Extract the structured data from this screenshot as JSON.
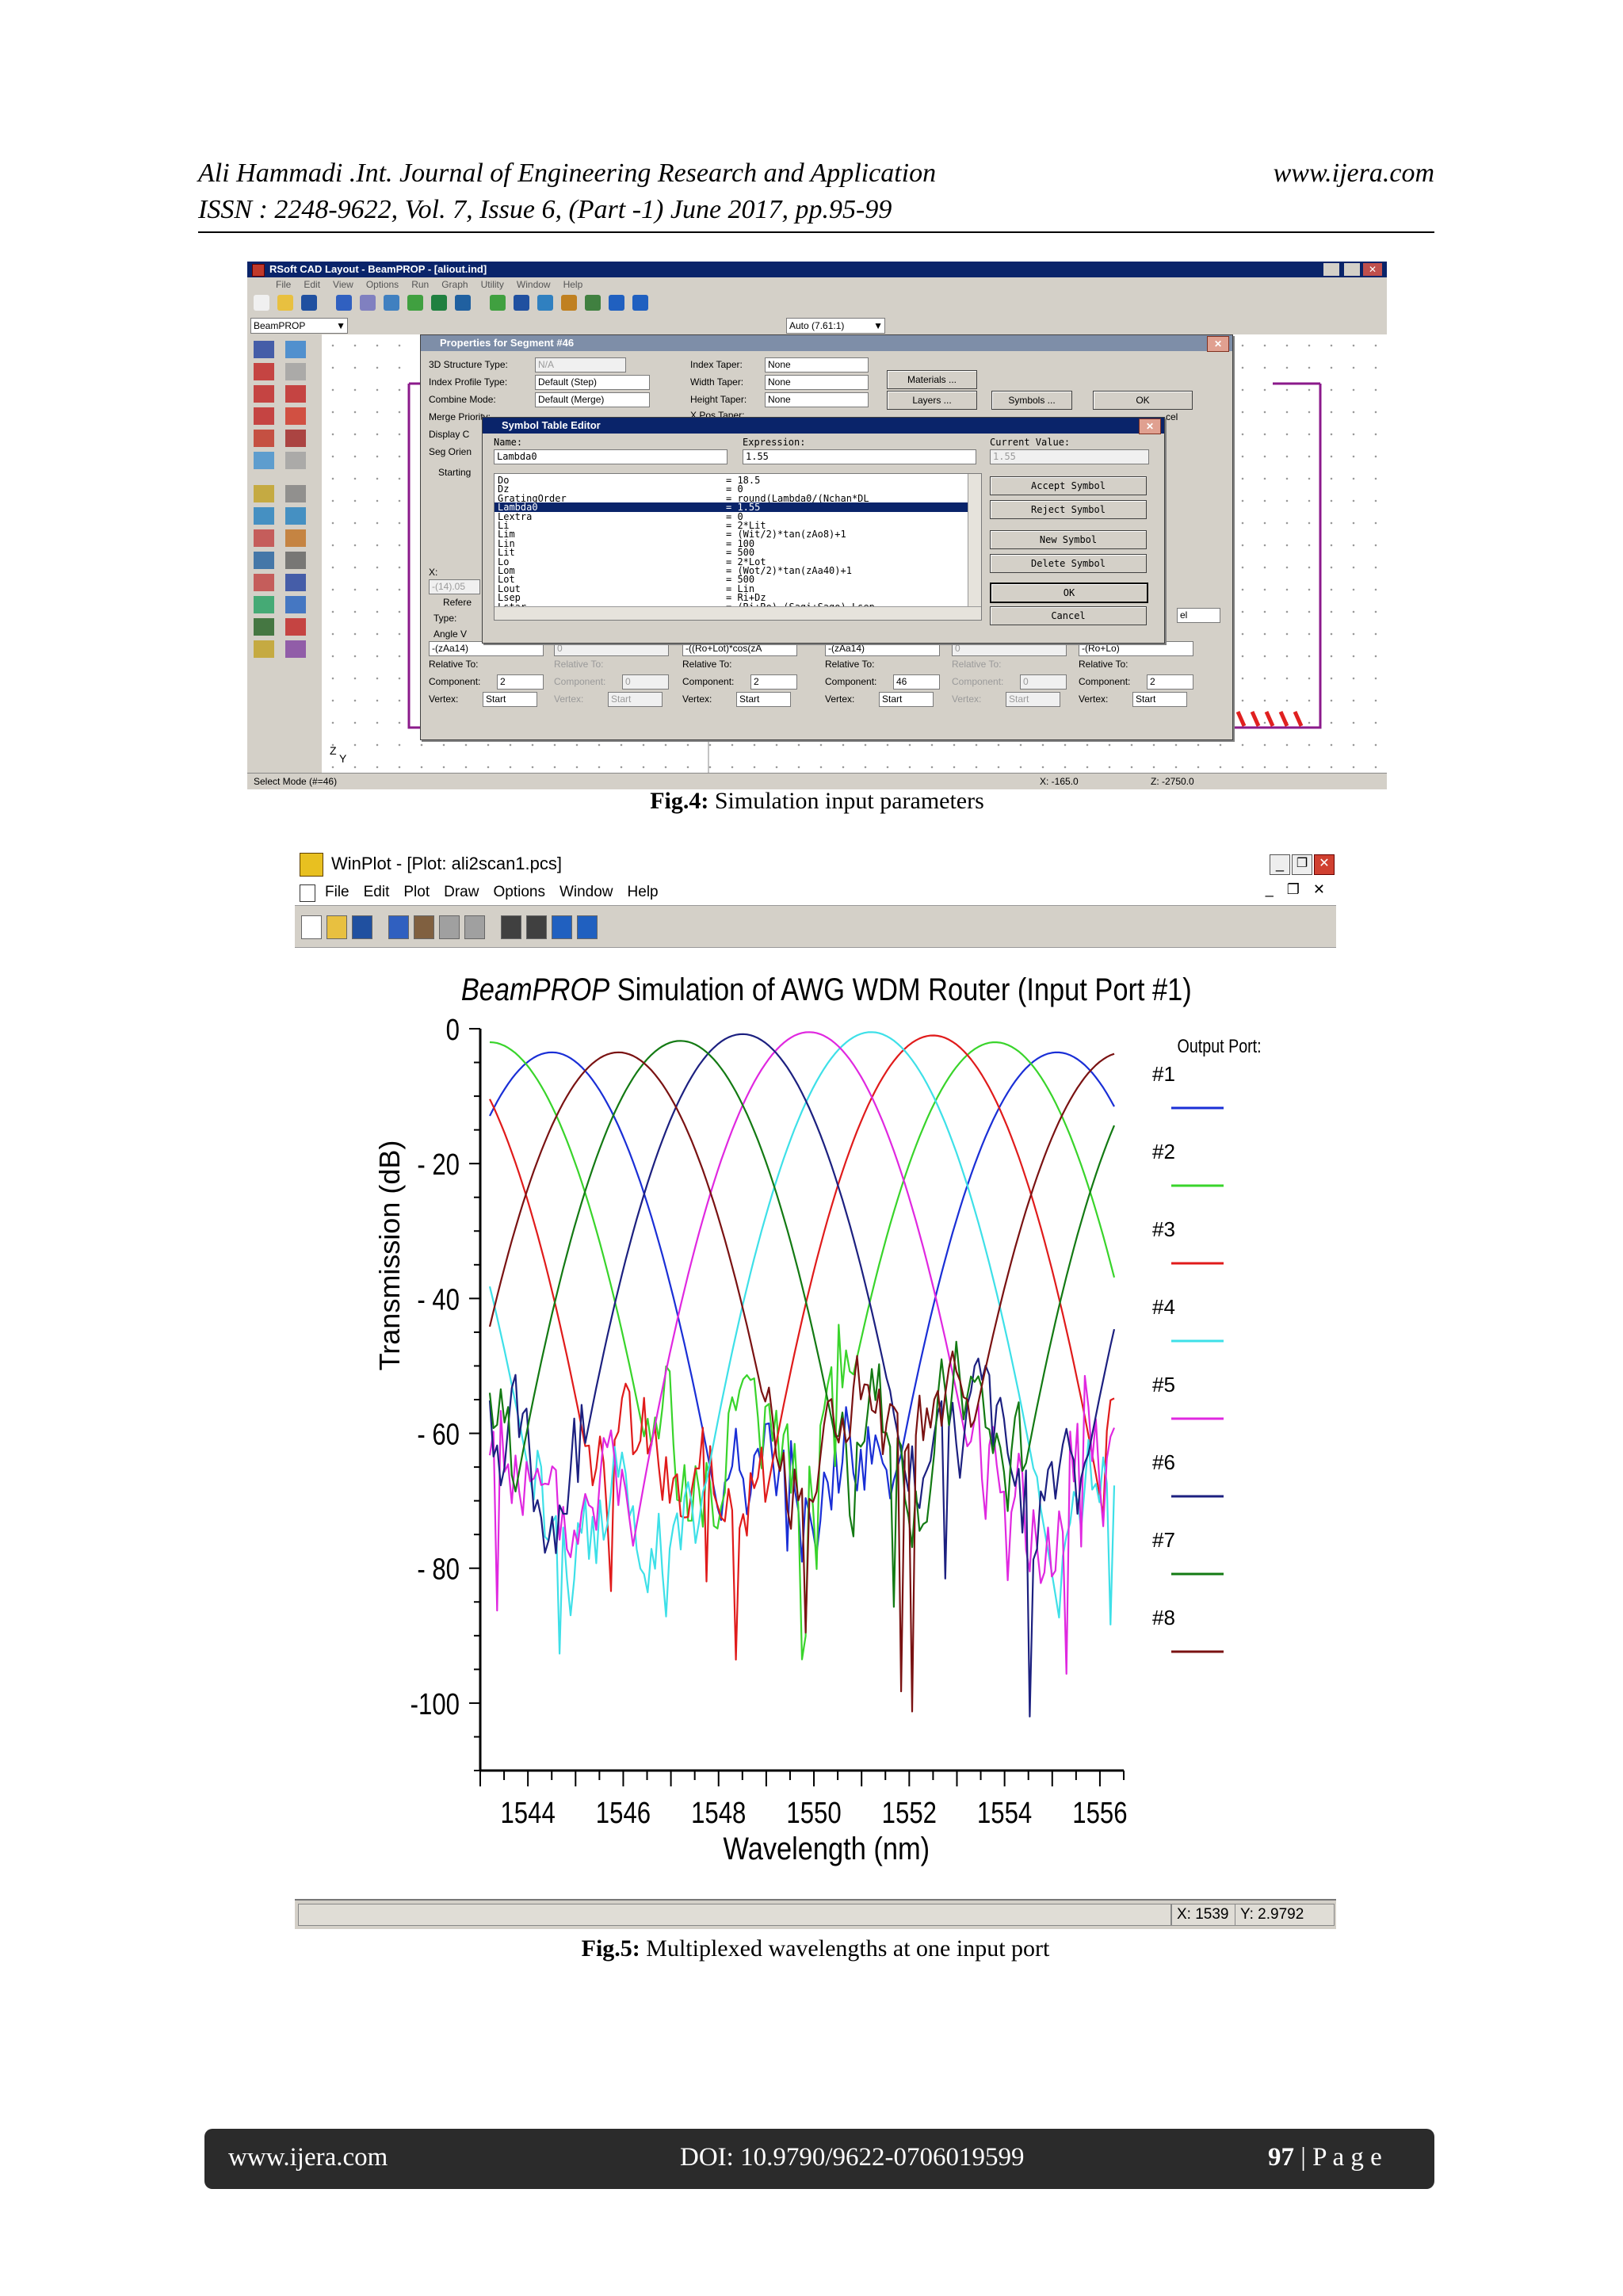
{
  "header": {
    "left_line1": "Ali Hammadi .Int. Journal of Engineering Research and Application",
    "right_line1": "www.ijera.com",
    "left_line2": "ISSN : 2248-9622, Vol. 7, Issue 6, (Part -1) June 2017, pp.95-99"
  },
  "fig4": {
    "caption_bold": "Fig.4:",
    "caption_text": " Simulation input parameters",
    "window": {
      "title": "RSoft CAD Layout - BeamPROP - [aliout.ind]",
      "menus": [
        "File",
        "Edit",
        "View",
        "Options",
        "Run",
        "Graph",
        "Utility",
        "Window",
        "Help"
      ],
      "program_select": "BeamPROP",
      "zoom_select": "Auto (7.61:1)",
      "status_left": "Select Mode (#=46)",
      "status_x": "X: -165.0",
      "status_z": "Z: -2750.0"
    },
    "properties": {
      "title": "Properties for Segment #46",
      "structure_label": "3D Structure Type:",
      "structure_value": "N/A",
      "profile_label": "Index Profile Type:",
      "profile_value": "Default (Step)",
      "combine_label": "Combine Mode:",
      "combine_value": "Default (Merge)",
      "merge_label": "Merge Priority:",
      "display_label": "Display C",
      "segorient_label": "Seg Orien",
      "starting_label": "Starting",
      "index_taper_label": "Index Taper:",
      "index_taper_value": "None",
      "width_taper_label": "Width Taper:",
      "width_taper_value": "None",
      "height_taper_label": "Height Taper:",
      "height_taper_value": "None",
      "xpos_label": "X Pos Taper:",
      "btn_materials": "Materials ...",
      "btn_layers": "Layers ...",
      "btn_symbols": "Symbols ...",
      "btn_ok": "OK",
      "btn_cancel_partial": "cel",
      "x_label": "X:",
      "x_value": "-(14).05",
      "reference_label": "Refere",
      "type_label": "Type:",
      "angle_label": "Angle V",
      "sel_label": "el",
      "rows": [
        {
          "expr": "-(zAa14)",
          "relative": "Relative To:",
          "component_label": "Component:",
          "component": "2",
          "vertex_label": "Vertex:",
          "vertex": "Start",
          "disabled": false
        },
        {
          "expr": "0",
          "relative": "Relative To:",
          "component_label": "Component:",
          "component": "0",
          "vertex_label": "Vertex:",
          "vertex": "Start",
          "disabled": true
        },
        {
          "expr": "-((Ro+Lot)*cos(zA",
          "relative": "Relative To:",
          "component_label": "Component:",
          "component": "2",
          "vertex_label": "Vertex:",
          "vertex": "Start",
          "disabled": false
        },
        {
          "expr": "-(zAa14)",
          "relative": "Relative To:",
          "component_label": "Component:",
          "component": "46",
          "vertex_label": "Vertex:",
          "vertex": "Start",
          "disabled": false
        },
        {
          "expr": "0",
          "relative": "Relative To:",
          "component_label": "Component:",
          "component": "0",
          "vertex_label": "Vertex:",
          "vertex": "Start",
          "disabled": true
        },
        {
          "expr": "-(Ro+Lo)",
          "relative": "Relative To:",
          "component_label": "Component:",
          "component": "2",
          "vertex_label": "Vertex:",
          "vertex": "Start",
          "disabled": false
        }
      ]
    },
    "symbol_editor": {
      "title": "Symbol Table Editor",
      "name_label": "Name:",
      "name_value": "Lambda0",
      "expr_label": "Expression:",
      "expr_value": "1.55",
      "current_label": "Current Value:",
      "current_value": "1.55",
      "symbols": [
        {
          "name": "Do",
          "expr": "= 18.5"
        },
        {
          "name": "Dz",
          "expr": "= 0"
        },
        {
          "name": "GratingOrder",
          "expr": "= round(Lambda0/(Nchan*DL"
        },
        {
          "name": "Lambda0",
          "expr": "= 1.55"
        },
        {
          "name": "Lextra",
          "expr": "= 0"
        },
        {
          "name": "Li",
          "expr": "= 2*Lit"
        },
        {
          "name": "Lim",
          "expr": "= (Wit/2)*tan(zAo8)+1"
        },
        {
          "name": "Lin",
          "expr": "= 100"
        },
        {
          "name": "Lit",
          "expr": "= 500"
        },
        {
          "name": "Lo",
          "expr": "= 2*Lot"
        },
        {
          "name": "Lom",
          "expr": "= (Wot/2)*tan(zAa40)+1"
        },
        {
          "name": "Lot",
          "expr": "= 500"
        },
        {
          "name": "Lout",
          "expr": "= Lin"
        },
        {
          "name": "Lsep",
          "expr": "= Ri+Dz"
        },
        {
          "name": "Lstar",
          "expr": "= (Ri+Ro)-(Sagi+Sago)-Lsep"
        }
      ],
      "btn_accept": "Accept Symbol",
      "btn_reject": "Reject Symbol",
      "btn_new": "New Symbol",
      "btn_delete": "Delete Symbol",
      "btn_ok": "OK",
      "btn_cancel": "Cancel",
      "side_fragments": [
        "se",
        "at"
      ]
    }
  },
  "fig5": {
    "caption_bold": "Fig.5:",
    "caption_text": " Multiplexed wavelengths at one input port",
    "window": {
      "title": "WinPlot - [Plot: ali2scan1.pcs]",
      "menus": [
        "File",
        "Edit",
        "Plot",
        "Draw",
        "Options",
        "Window",
        "Help"
      ],
      "status_x": "X: 1539",
      "status_y": "Y: 2.9792"
    },
    "chart_data": {
      "type": "line",
      "title_italic": "BeamPROP",
      "title_rest": " Simulation of AWG WDM Router (Input Port #1)",
      "xlabel": "Wavelength (nm)",
      "ylabel": "Transmission (dB)",
      "xlim": [
        1543.0,
        1556.5
      ],
      "ylim": [
        -110,
        0
      ],
      "xticks": [
        1544,
        1546,
        1548,
        1550,
        1552,
        1554,
        1556
      ],
      "xtick_labels": [
        "1544",
        "1546",
        "1548",
        "1550",
        "1552",
        "1554",
        "1556"
      ],
      "yticks": [
        0,
        -20,
        -40,
        -60,
        -80,
        -100
      ],
      "ytick_labels": [
        "0",
        "- 20",
        "- 40",
        "- 60",
        "- 80",
        "-100"
      ],
      "legend_title": "Output Port:",
      "legend_position": "right",
      "series": [
        {
          "name": "#1",
          "color": "#1a2fd6",
          "peak": 1555.1,
          "peak_db": -3.5,
          "noise_seed": 1,
          "floor": -66
        },
        {
          "name": "#2",
          "color": "#39d42b",
          "peak": 1553.8,
          "peak_db": -2.0,
          "noise_seed": 2,
          "floor": -62
        },
        {
          "name": "#3",
          "color": "#e01b1b",
          "peak": 1552.5,
          "peak_db": -1.0,
          "noise_seed": 3,
          "floor": -66
        },
        {
          "name": "#4",
          "color": "#3ee0e8",
          "peak": 1551.2,
          "peak_db": -0.5,
          "noise_seed": 4,
          "floor": -72
        },
        {
          "name": "#5",
          "color": "#e028e0",
          "peak": 1549.9,
          "peak_db": -0.5,
          "noise_seed": 5,
          "floor": -70
        },
        {
          "name": "#6",
          "color": "#1c2080",
          "peak": 1548.5,
          "peak_db": -0.8,
          "noise_seed": 6,
          "floor": -64
        },
        {
          "name": "#7",
          "color": "#137a13",
          "peak": 1547.2,
          "peak_db": -1.8,
          "noise_seed": 7,
          "floor": -60
        },
        {
          "name": "#8",
          "color": "#7a1212",
          "peak": 1545.9,
          "peak_db": -3.5,
          "noise_seed": 8,
          "floor": -62
        }
      ]
    }
  },
  "footer": {
    "left": "www.ijera.com",
    "center": "DOI: 10.9790/9622-0706019599",
    "page_num": "97",
    "page_label": " | P a g e"
  }
}
